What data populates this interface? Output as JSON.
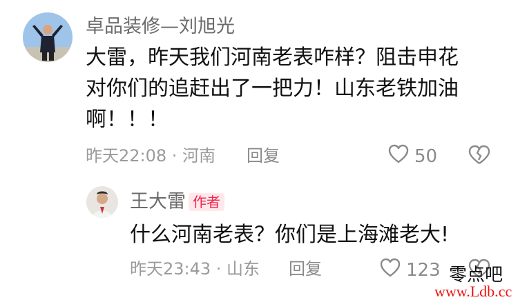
{
  "comment": {
    "author": "卓品装修—刘旭光",
    "lines": [
      "大雷，昨天我们河南老表咋样？阻击申花",
      "对你们的追赶出了一把力！山东老铁加油",
      "啊！！！"
    ],
    "meta": "昨天22:08 · 河南",
    "reply_label": "回复",
    "likes": "50"
  },
  "reply": {
    "author": "王大雷",
    "badge": "作者",
    "text": "什么河南老表？你们是上海滩老大!",
    "meta": "昨天23:43 · 山东",
    "reply_label": "回复",
    "likes": "123"
  },
  "watermark": {
    "line1": "零点吧",
    "line2": "www.Ldb.cc"
  },
  "icons": {
    "like": "heart-outline-icon",
    "dislike": "broken-heart-icon"
  }
}
